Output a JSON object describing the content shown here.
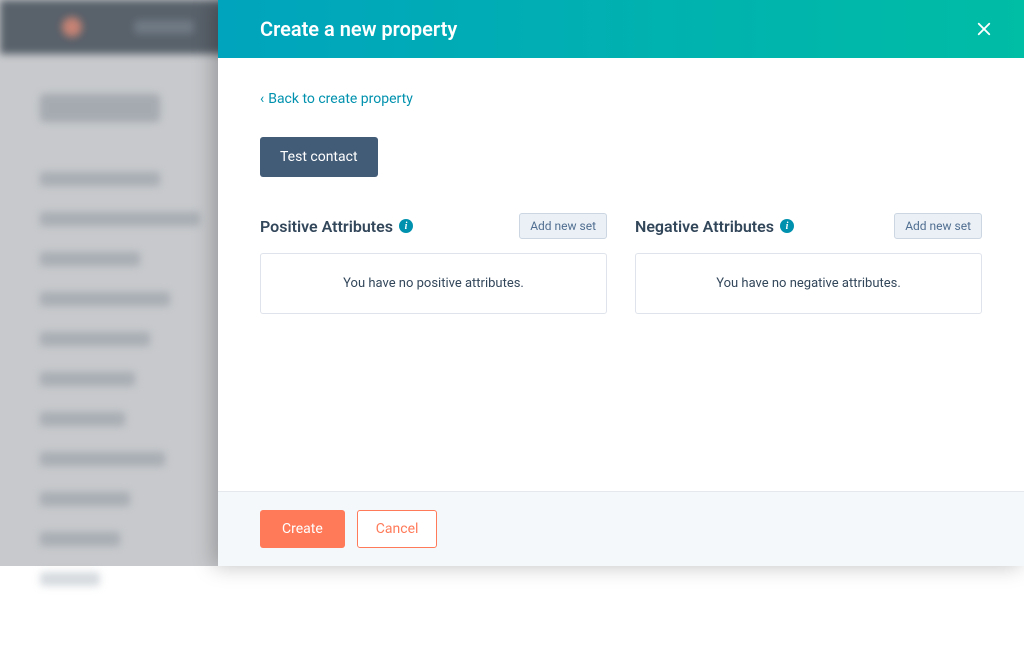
{
  "panel": {
    "title": "Create a new property",
    "back_label": "Back to create property",
    "test_contact_label": "Test contact"
  },
  "positive": {
    "title": "Positive Attributes",
    "add_label": "Add new set",
    "empty_message": "You have no positive attributes."
  },
  "negative": {
    "title": "Negative Attributes",
    "add_label": "Add new set",
    "empty_message": "You have no negative attributes."
  },
  "footer": {
    "create_label": "Create",
    "cancel_label": "Cancel"
  }
}
